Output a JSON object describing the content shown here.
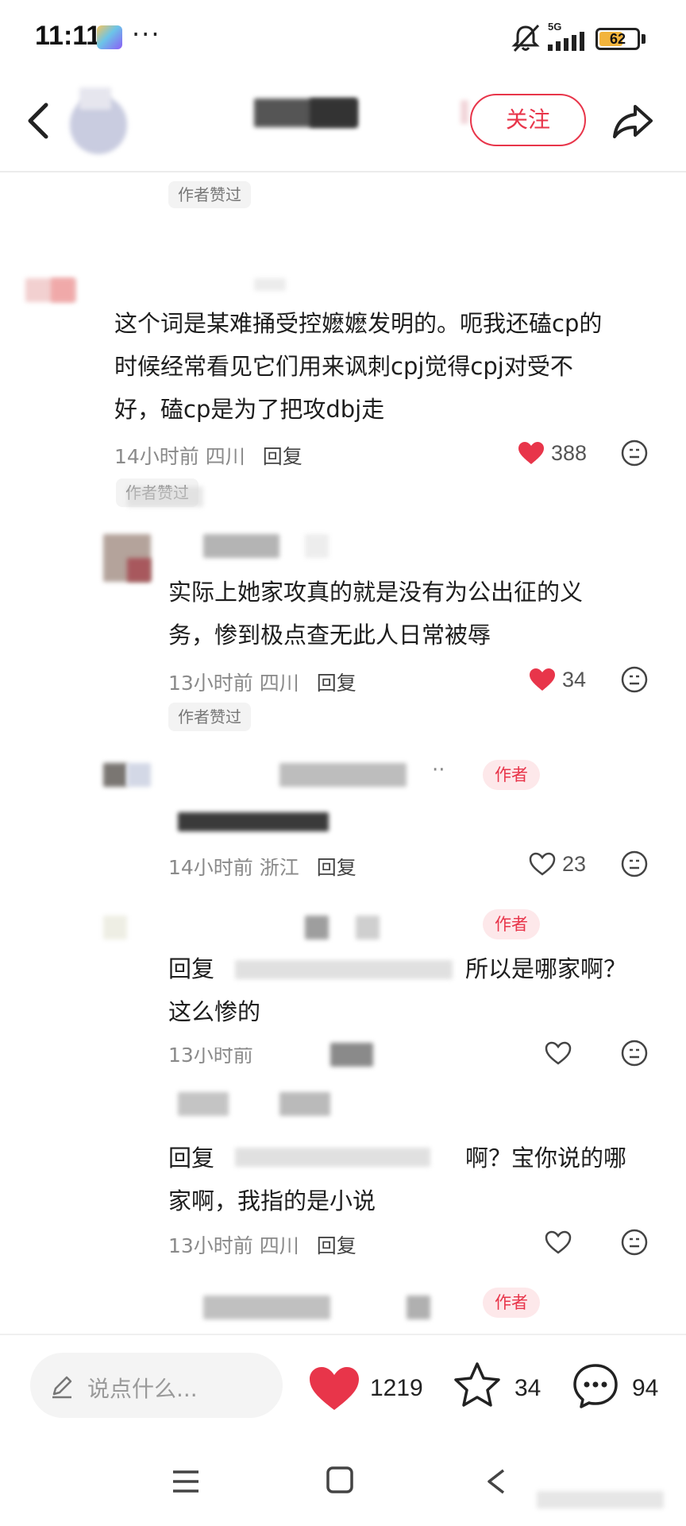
{
  "status_bar": {
    "time": "11:11",
    "dots": "···",
    "network": "5G",
    "battery": "62",
    "battery_level": 0.62
  },
  "header": {
    "follow_label": "关注"
  },
  "comments": [
    {
      "badge_liked": "作者赞过"
    },
    {
      "text": [
        "这个词是某难捅受控嬷嬷发明的。呃我还磕cp的",
        "时候经常看见它们用来讽刺cpj觉得cpj对受不",
        "好，磕cp是为了把攻dbj走"
      ],
      "time": "14小时前",
      "location": "四川",
      "reply_label": "回复",
      "likes": "388",
      "liked": true,
      "badge_liked": "作者赞过"
    },
    {
      "text": [
        "实际上她家攻真的就是没有为公出征的义",
        "务，惨到极点查无此人日常被辱"
      ],
      "time": "13小时前",
      "location": "四川",
      "reply_label": "回复",
      "likes": "34",
      "liked": true,
      "badge_liked": "作者赞过"
    },
    {
      "badge_author": "作者",
      "dots": "··",
      "time": "14小时前",
      "location": "浙江",
      "reply_label": "回复",
      "likes": "23",
      "liked": false
    },
    {
      "badge_author": "作者",
      "reply_prefix": "回复",
      "text": [
        "所以是哪家啊？",
        "这么惨的"
      ],
      "time": "13小时前"
    },
    {
      "reply_prefix": "回复",
      "text": [
        "啊？宝你说的哪",
        "家啊，我指的是小说"
      ],
      "time": "13小时前",
      "location": "四川",
      "reply_label": "回复"
    },
    {
      "badge_author": "作者"
    }
  ],
  "bottom_bar": {
    "placeholder": "说点什么...",
    "likes": "1219",
    "stars": "34",
    "comments": "94"
  },
  "colors": {
    "accent": "#e8354a",
    "liked_heart": "#e8354a",
    "muted_text": "#8a8a8a"
  },
  "icons": [
    "back-icon",
    "share-icon",
    "heart-icon",
    "emoji-icon",
    "pencil-icon",
    "star-icon",
    "comment-icon",
    "menu-icon",
    "home-icon",
    "back-nav-icon",
    "mute-icon",
    "signal-icon",
    "battery-icon"
  ]
}
